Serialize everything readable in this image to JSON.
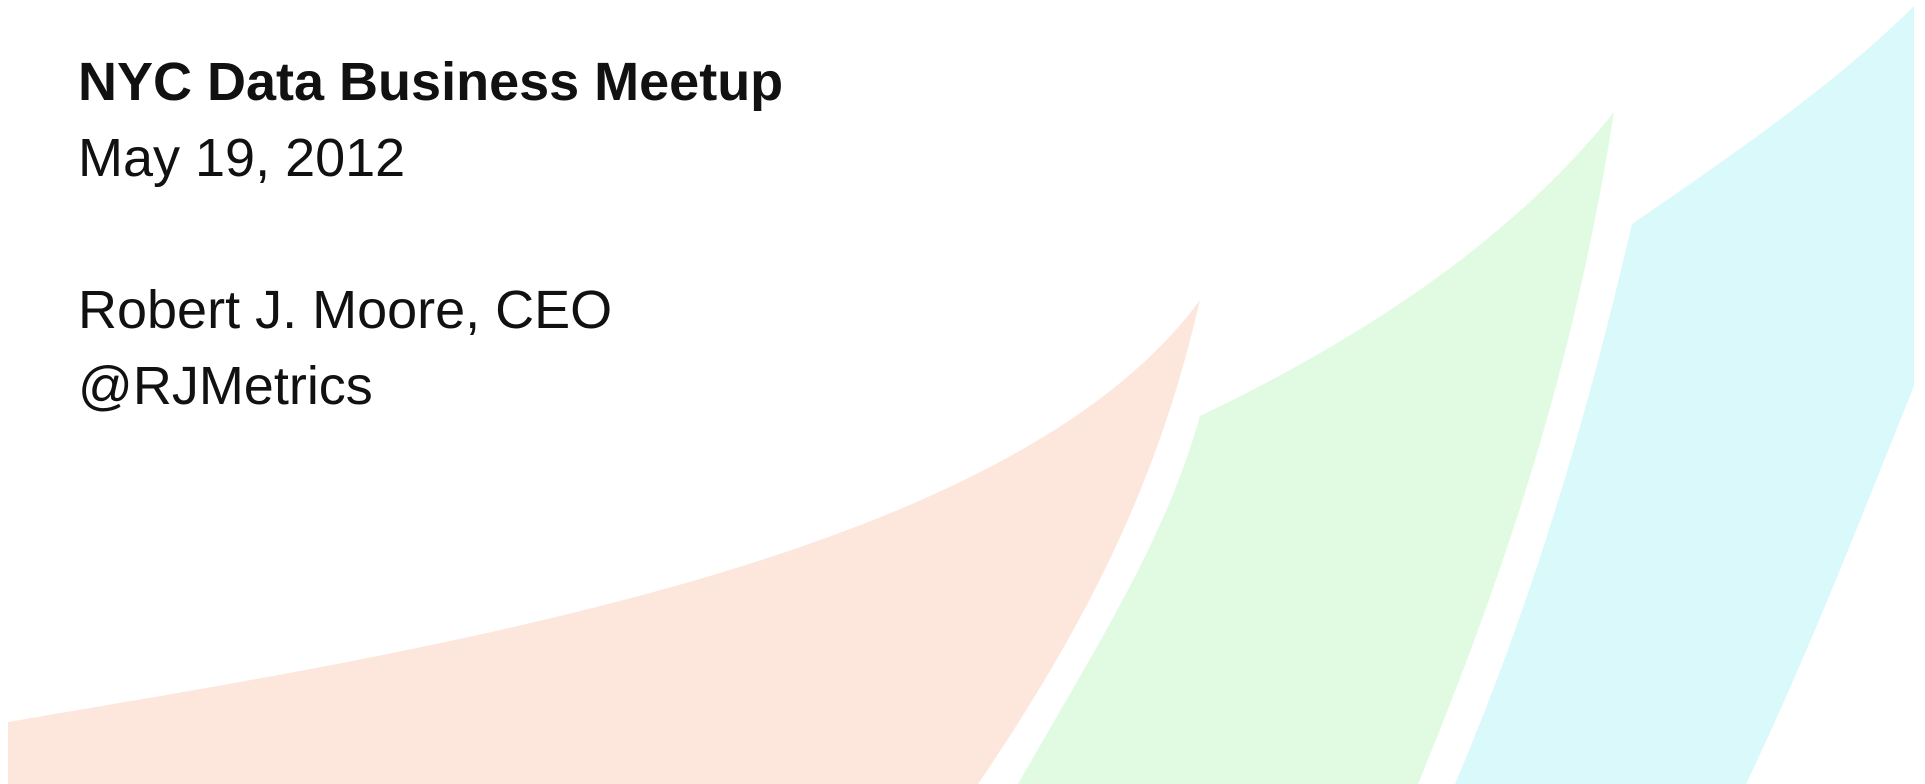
{
  "slide": {
    "title": "NYC Data Business Meetup",
    "date": "May 19, 2012",
    "presenter": "Robert J. Moore, CEO",
    "handle": "@RJMetrics"
  },
  "colors": {
    "background": "#ffffff",
    "text": "#111111",
    "swoosh_peach": "#fde6db",
    "swoosh_green": "#e0fbe2",
    "swoosh_cyan": "#d9f9fb"
  }
}
